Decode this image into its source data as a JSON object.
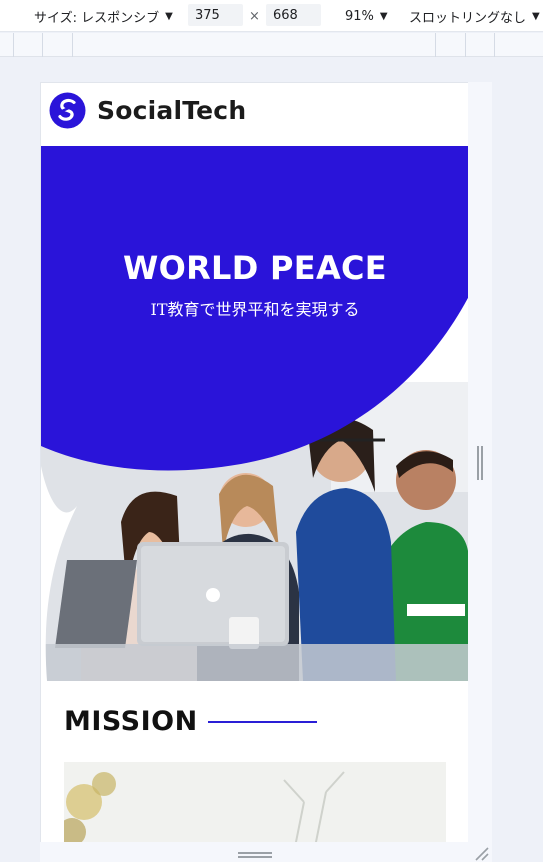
{
  "devtools": {
    "size_label": "サイズ: レスポンシブ",
    "width": "375",
    "times": "×",
    "height": "668",
    "zoom": "91%",
    "throttling": "スロットリングなし",
    "caret": "▼"
  },
  "site": {
    "brand": "SocialTech",
    "hero_title": "WORLD PEACE",
    "hero_subtitle": "IT教育で世界平和を実現する",
    "mission_title": "MISSION"
  },
  "colors": {
    "brand_blue": "#2a14d9",
    "accent_line": "#2a1fd6"
  }
}
